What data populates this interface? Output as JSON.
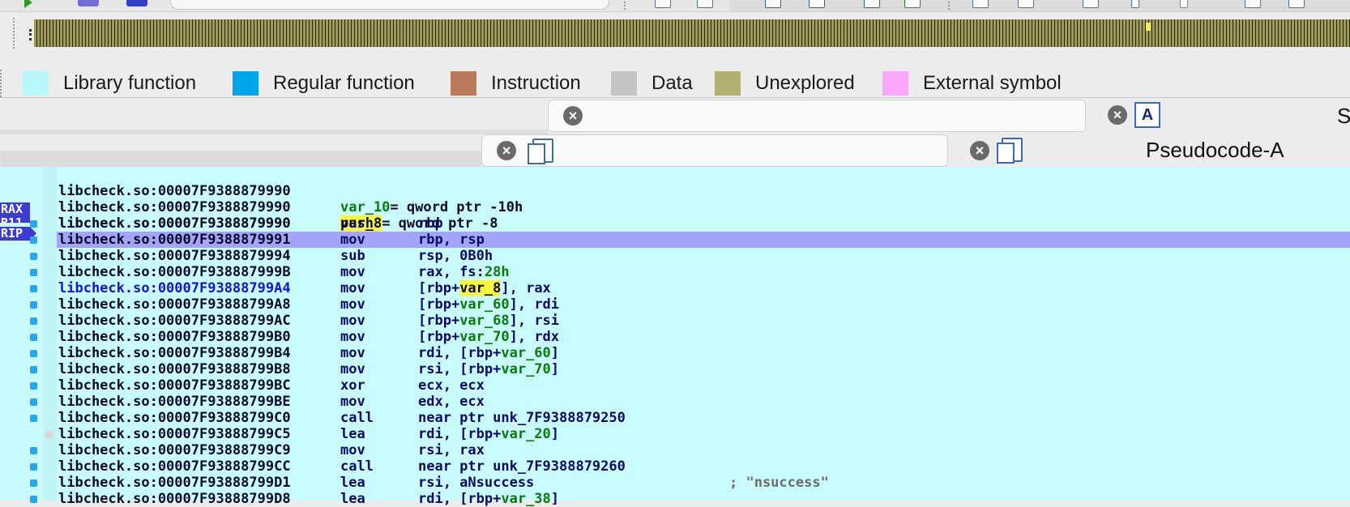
{
  "legend": [
    {
      "label": "Library function",
      "color": "#b8f8fb"
    },
    {
      "label": "Regular function",
      "color": "#00a4e8"
    },
    {
      "label": "Instruction",
      "color": "#bb7a5a"
    },
    {
      "label": "Data",
      "color": "#c4c4c4"
    },
    {
      "label": "Unexplored",
      "color": "#b2b06e"
    },
    {
      "label": "External symbol",
      "color": "#fba7fb"
    }
  ],
  "tabs": {
    "pseudocode_label": "Pseudocode-A",
    "partial_label": "S"
  },
  "registers": [
    "RAX",
    "R11",
    "RIP"
  ],
  "listing": {
    "header": [
      {
        "addr": "libcheck.so:00007F9388879990",
        "name": "var_10",
        "rest": "= qword ptr -10h"
      },
      {
        "addr": "libcheck.so:00007F9388879990",
        "name": "var_8",
        "rest": "= qword ptr -8"
      },
      {
        "addr": "libcheck.so:00007F9388879990"
      }
    ],
    "rows": [
      {
        "addr": "libcheck.so:00007F9388879990",
        "mn": "push",
        "op": "rbp"
      },
      {
        "addr": "libcheck.so:00007F9388879991",
        "mn": "mov",
        "op": "rbp, rsp"
      },
      {
        "addr": "libcheck.so:00007F9388879994",
        "mn": "sub",
        "op": "rsp, 0B0h"
      },
      {
        "addr": "libcheck.so:00007F938887999B",
        "mn": "mov",
        "op_a": "rax, fs:",
        "op_b": "28h"
      },
      {
        "addr": "libcheck.so:00007F93888799A4",
        "mn": "mov",
        "op_a": "[rbp+",
        "op_var": "var_8",
        "op_c": "], rax"
      },
      {
        "addr": "libcheck.so:00007F93888799A8",
        "mn": "mov",
        "op_a": "[rbp+",
        "op_var": "var_60",
        "op_c": "], rdi"
      },
      {
        "addr": "libcheck.so:00007F93888799AC",
        "mn": "mov",
        "op_a": "[rbp+",
        "op_var": "var_68",
        "op_c": "], rsi"
      },
      {
        "addr": "libcheck.so:00007F93888799B0",
        "mn": "mov",
        "op_a": "[rbp+",
        "op_var": "var_70",
        "op_c": "], rdx"
      },
      {
        "addr": "libcheck.so:00007F93888799B4",
        "mn": "mov",
        "op_a": "rdi, [rbp+",
        "op_var": "var_60",
        "op_c": "]"
      },
      {
        "addr": "libcheck.so:00007F93888799B8",
        "mn": "mov",
        "op_a": "rsi, [rbp+",
        "op_var": "var_70",
        "op_c": "]"
      },
      {
        "addr": "libcheck.so:00007F93888799BC",
        "mn": "xor",
        "op": "ecx, ecx"
      },
      {
        "addr": "libcheck.so:00007F93888799BE",
        "mn": "mov",
        "op": "edx, ecx"
      },
      {
        "addr": "libcheck.so:00007F93888799C0",
        "mn": "call",
        "op": "near ptr unk_7F9388879250"
      },
      {
        "addr": "libcheck.so:00007F93888799C5",
        "mn": "lea",
        "op_a": "rdi, [rbp+",
        "op_var": "var_20",
        "op_c": "]"
      },
      {
        "addr": "libcheck.so:00007F93888799C9",
        "mn": "mov",
        "op": "rsi, rax"
      },
      {
        "addr": "libcheck.so:00007F93888799CC",
        "mn": "call",
        "op": "near ptr unk_7F9388879260"
      },
      {
        "addr": "libcheck.so:00007F93888799D1",
        "mn": "lea",
        "op": "rsi, aNsuccess",
        "comment": "; \"nsuccess\""
      },
      {
        "addr": "libcheck.so:00007F93888799D8",
        "mn": "lea",
        "op_a": "rdi, [rbp+",
        "op_var": "var_38",
        "op_c": "]"
      }
    ]
  }
}
